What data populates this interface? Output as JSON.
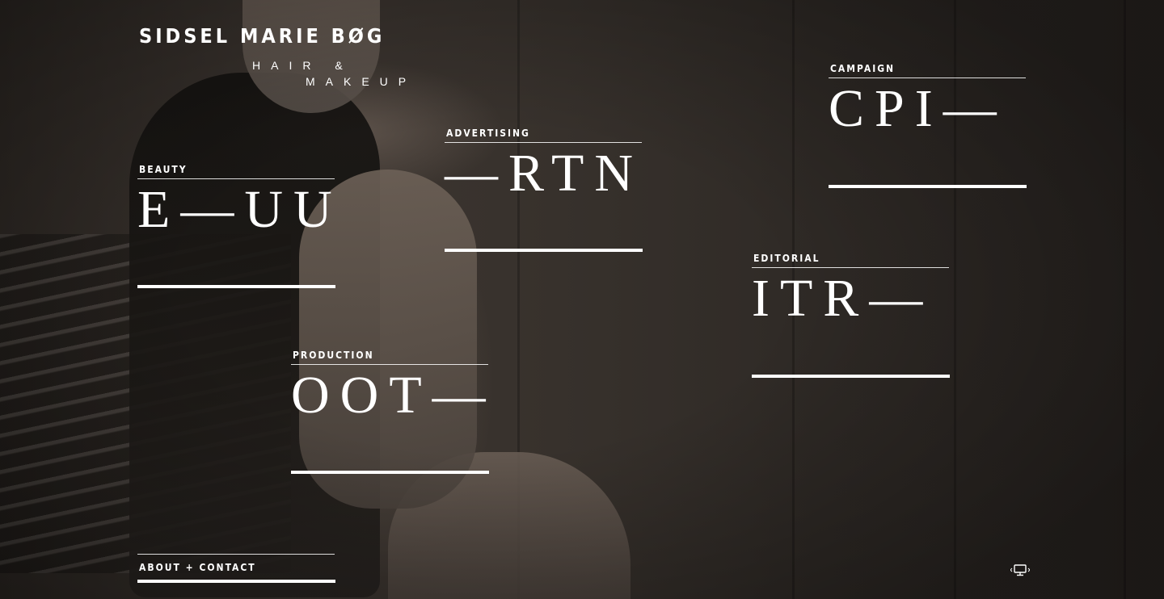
{
  "brand": {
    "name": "SIDSEL MARIE BØG",
    "tagline_line1": "HAIR &",
    "tagline_line2": "MAKEUP"
  },
  "categories": [
    {
      "label": "BEAUTY",
      "word": "E—UU"
    },
    {
      "label": "ADVERTISING",
      "word": "—RTN"
    },
    {
      "label": "CAMPAIGN",
      "word": "CPI—"
    },
    {
      "label": "EDITORIAL",
      "word": "ITR—"
    },
    {
      "label": "PRODUCTION",
      "word": "OOT—"
    }
  ],
  "footer": {
    "about_label": "ABOUT + CONTACT",
    "corner_icon": "monitor-icon"
  },
  "colors": {
    "text": "#ffffff",
    "background": "#2f2a26"
  }
}
